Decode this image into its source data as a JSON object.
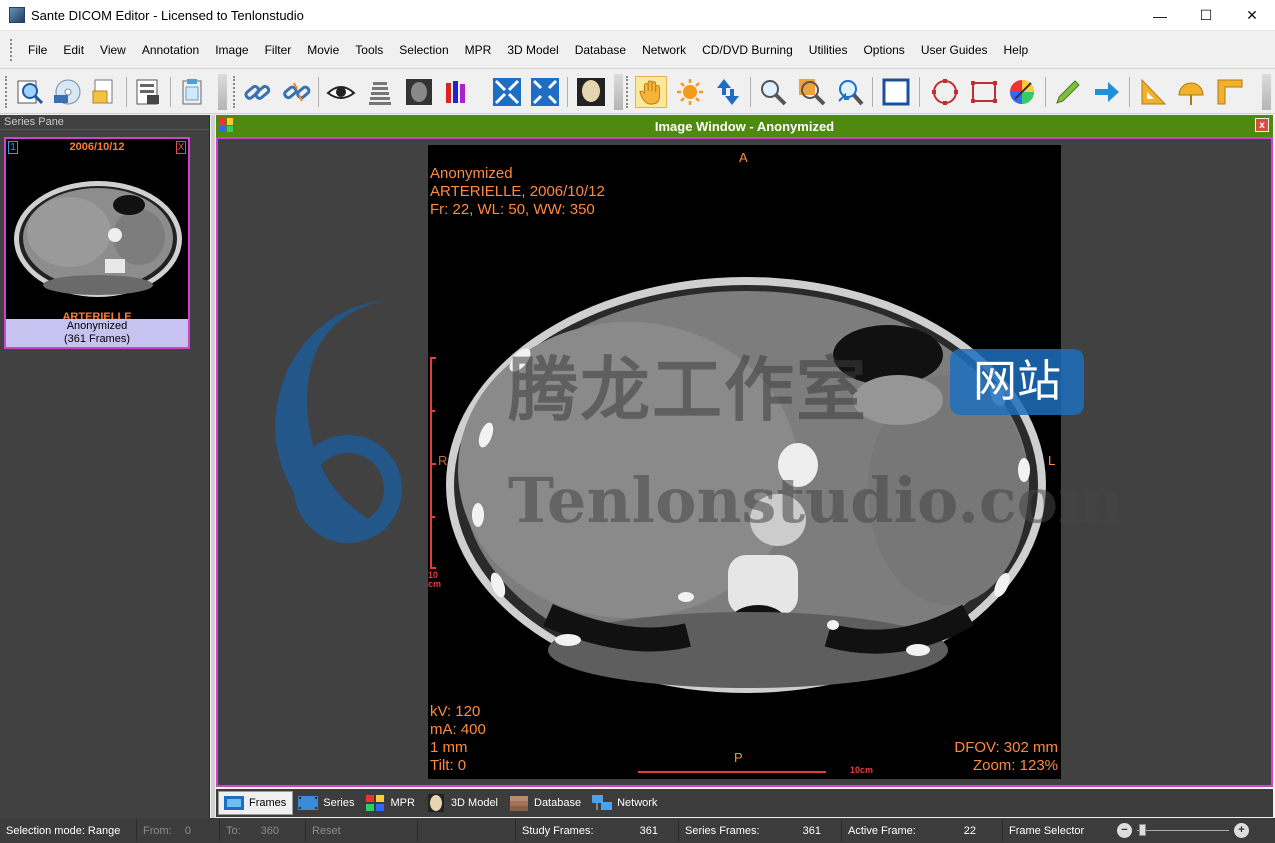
{
  "window": {
    "title": "Sante DICOM Editor - Licensed to Tenlonstudio",
    "minimize": "—",
    "maximize": "☐",
    "close": "✕"
  },
  "menu": [
    "File",
    "Edit",
    "View",
    "Annotation",
    "Image",
    "Filter",
    "Movie",
    "Tools",
    "Selection",
    "MPR",
    "3D Model",
    "Database",
    "Network",
    "CD/DVD Burning",
    "Utilities",
    "Options",
    "User Guides",
    "Help"
  ],
  "series_pane": {
    "header": "Series Pane",
    "thumb": {
      "index": "1",
      "close": "X",
      "date": "2006/10/12",
      "series": "ARTERIELLE",
      "patient": "Anonymized",
      "frames": "(361 Frames)"
    }
  },
  "image_window": {
    "title": "Image Window - Anonymized",
    "close": "x",
    "overlay": {
      "top_left": [
        "Anonymized",
        "ARTERIELLE, 2006/10/12",
        "Fr: 22, WL: 50, WW: 350"
      ],
      "bottom_left": [
        "kV: 120",
        "mA: 400",
        "1 mm",
        "Tilt: 0"
      ],
      "bottom_right": [
        "DFOV: 302 mm",
        "Zoom: 123%"
      ],
      "orient_top": "A",
      "orient_bottom": "P",
      "orient_left": "R",
      "orient_right": "L",
      "scale_left": "10",
      "scale_left_unit": "cm",
      "scale_bottom": "10cm"
    },
    "watermark": {
      "cn": "腾龙工作室",
      "badge": "网站",
      "en": "Tenlonstudio.com"
    }
  },
  "bottom_tabs": [
    "Frames",
    "Series",
    "MPR",
    "3D Model",
    "Database",
    "Network"
  ],
  "status": {
    "selection_mode": "Selection mode: Range",
    "from_label": "From:",
    "from_value": "0",
    "to_label": "To:",
    "to_value": "360",
    "reset": "Reset",
    "study_frames_label": "Study Frames:",
    "study_frames_value": "361",
    "series_frames_label": "Series Frames:",
    "series_frames_value": "361",
    "active_frame_label": "Active Frame:",
    "active_frame_value": "22",
    "frame_selector": "Frame Selector"
  },
  "colors": {
    "accent_magenta": "#cc44cc",
    "overlay_orange": "#ff8a3d",
    "title_green": "#4f8a10"
  }
}
